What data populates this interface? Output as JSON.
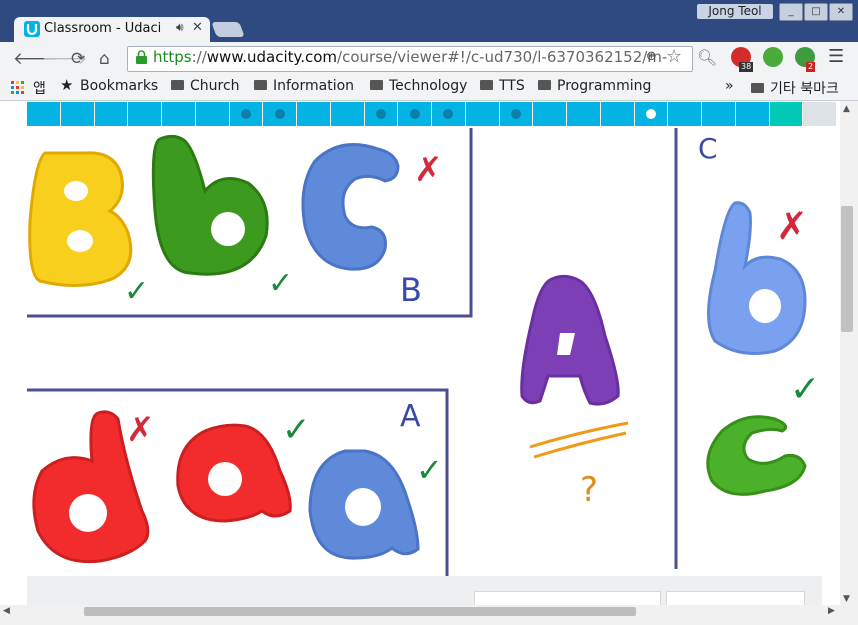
{
  "browser": {
    "user_name": "Jong Teol",
    "tab_title": "Classroom - Udaci",
    "url_scheme": "https",
    "url_sep": "://",
    "url_host": "www.udacity.com",
    "url_path": "/course/viewer#!/c-ud730/l-6370362152/m-",
    "extension_badges": [
      "38",
      "2"
    ],
    "accent_color": "#02b3e4"
  },
  "bookmarks": {
    "apps_label": "앱",
    "bookmarks_label": "Bookmarks",
    "folders": [
      "Church",
      "Information",
      "Technology",
      "TTS",
      "Programming"
    ],
    "more_label": "»",
    "other_label": "기타 북마크"
  },
  "progress": {
    "segments": 24,
    "dot_segments": [
      6,
      7,
      10,
      11,
      12,
      14
    ],
    "current_segment": 18,
    "completed_color": "#02b3e4",
    "current_color": "#00c9b7",
    "pending_color": "#dde2e6"
  },
  "lesson": {
    "annotations": {
      "b_upper": "✓",
      "b_lower": "✓",
      "c_upper": "✗",
      "c_label": "B",
      "d_lower": "✗",
      "a_red": "✓",
      "a_label": "A",
      "a_blue": "✓",
      "query": "?",
      "c_right": "C",
      "b_blue": "✗",
      "c_green": "✓"
    }
  }
}
